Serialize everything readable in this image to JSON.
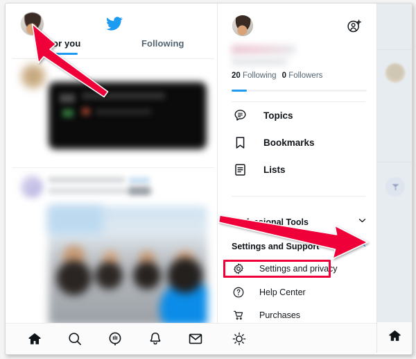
{
  "app": {
    "name": "Twitter",
    "logo_icon": "twitter-bird-icon"
  },
  "timeline": {
    "avatar_icon": "profile-avatar",
    "tabs": [
      {
        "label": "For you",
        "active": true
      },
      {
        "label": "Following",
        "active": false
      }
    ],
    "posts_note": "blurred feed content"
  },
  "drawer": {
    "avatar_icon": "profile-avatar",
    "add_person_icon": "add-person-icon",
    "display_name": "",
    "handle": "",
    "stats": {
      "following_count": "20",
      "following_label": "Following",
      "followers_count": "0",
      "followers_label": "Followers"
    },
    "menu": [
      {
        "label": "Topics",
        "icon": "topics-icon"
      },
      {
        "label": "Bookmarks",
        "icon": "bookmark-icon"
      },
      {
        "label": "Lists",
        "icon": "lists-icon"
      }
    ],
    "sections": [
      {
        "label": "Professional Tools",
        "icon": "chevron-down-icon",
        "expanded": false
      },
      {
        "label": "Settings and Support",
        "icon": "chevron-up-icon",
        "expanded": true
      }
    ],
    "sub_items": [
      {
        "label": "Settings and privacy",
        "icon": "gear-icon",
        "highlighted": true
      },
      {
        "label": "Help Center",
        "icon": "help-circle-icon",
        "highlighted": false
      },
      {
        "label": "Purchases",
        "icon": "cart-icon",
        "highlighted": false
      }
    ],
    "theme_toggle": {
      "icon": "sun-icon",
      "label": ""
    }
  },
  "bottom_nav": [
    {
      "icon": "home-icon",
      "label": "Home",
      "active": true
    },
    {
      "icon": "search-icon",
      "label": "Search",
      "active": false
    },
    {
      "icon": "spaces-icon",
      "label": "Spaces",
      "active": false
    },
    {
      "icon": "bell-icon",
      "label": "Notifications",
      "active": false
    },
    {
      "icon": "mail-icon",
      "label": "Messages",
      "active": false
    }
  ],
  "right_column": {
    "avatar_1_icon": "blurred-avatar",
    "avatar_2_icon": "blurred-avatar",
    "home_icon": "home-icon"
  },
  "annotations": {
    "arrow_1": {
      "target": "profile-avatar",
      "color": "#ef0039"
    },
    "arrow_2": {
      "target": "settings-and-support-chevron",
      "color": "#ef0039"
    },
    "highlight_box": {
      "target": "Settings and privacy",
      "color": "#ef0039"
    }
  },
  "colors": {
    "accent_blue": "#1d9bf0",
    "annotation_red": "#ef0039",
    "text_primary": "#0f1419",
    "text_secondary": "#536471",
    "right_column_bg": "#e6ecf0"
  }
}
